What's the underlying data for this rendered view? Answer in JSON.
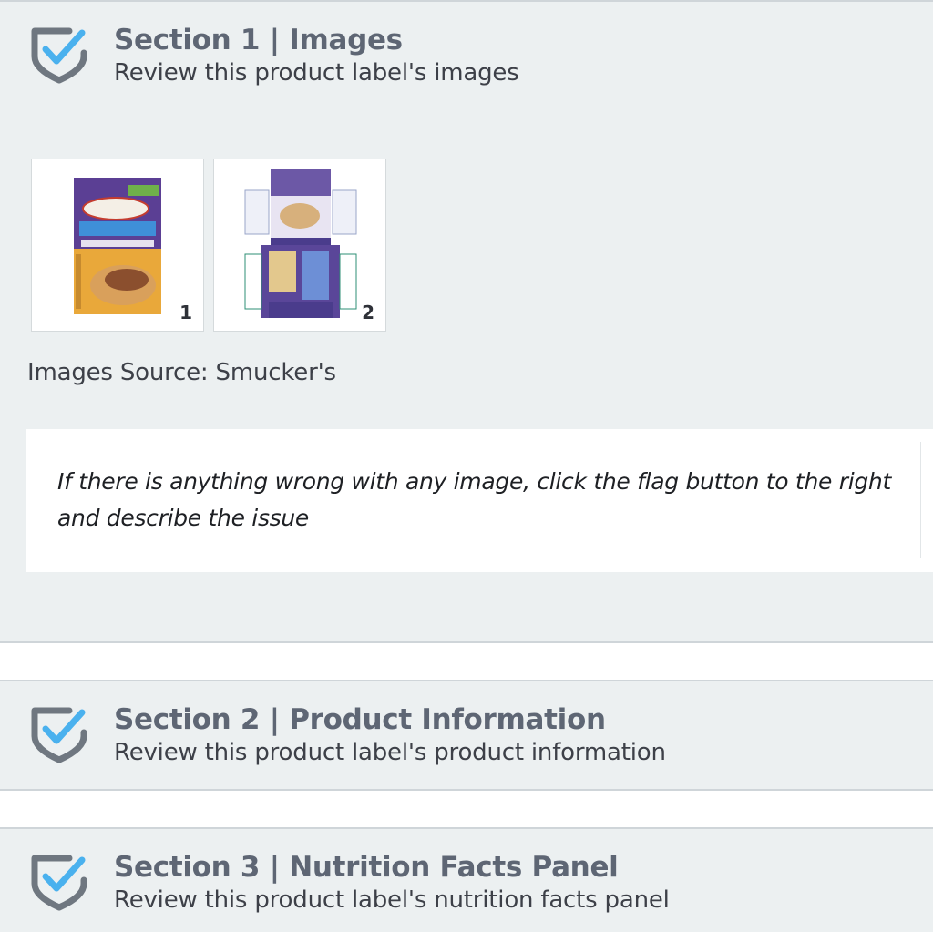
{
  "sections": [
    {
      "title": "Section 1 | Images",
      "subtitle": "Review this product label's images",
      "icon": "shield-check-icon",
      "images": [
        {
          "number": "1"
        },
        {
          "number": "2"
        }
      ],
      "images_source": "Images Source: Smucker's",
      "notice": "If there is anything wrong with any image, click the flag button to the right and describe the issue"
    },
    {
      "title": "Section 2 | Product Information",
      "subtitle": "Review this product label's product information",
      "icon": "shield-check-icon"
    },
    {
      "title": "Section 3 | Nutrition Facts Panel",
      "subtitle": "Review this product label's nutrition facts panel",
      "icon": "shield-check-icon"
    }
  ],
  "colors": {
    "panel_background": "#ecf0f1",
    "shield_gray": "#6f7780",
    "check_blue": "#4ab1ee",
    "title_gray": "#5e6674"
  }
}
